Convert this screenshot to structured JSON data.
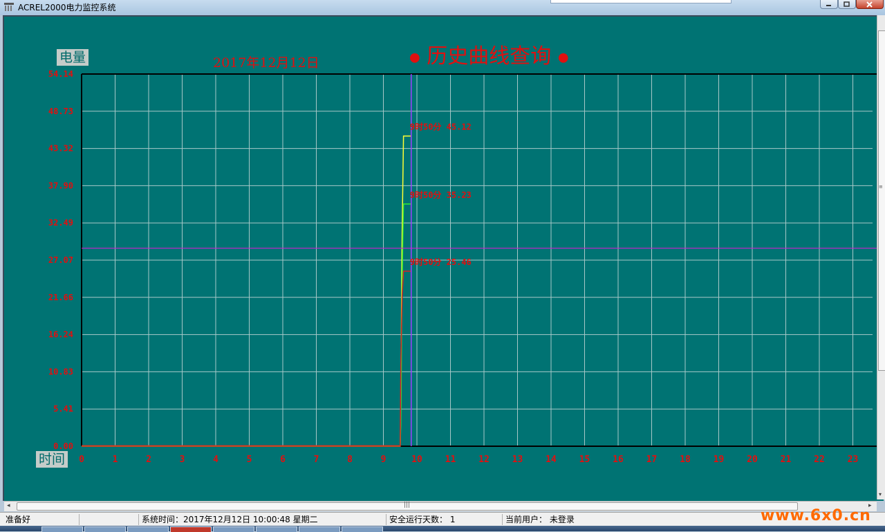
{
  "window": {
    "title": "ACREL2000电力监控系统"
  },
  "chart_labels": {
    "y_box": "电量",
    "x_box": "时间",
    "date": "2017年12月12日",
    "title": "历史曲线查询"
  },
  "chart_data": {
    "type": "line",
    "title": "历史曲线查询",
    "subtitle": "2017年12月12日",
    "xlabel": "时间",
    "ylabel": "电量",
    "xlim": [
      0,
      24
    ],
    "ylim": [
      0,
      54.14
    ],
    "x_ticks": [
      "0",
      "1",
      "2",
      "3",
      "4",
      "5",
      "6",
      "7",
      "8",
      "9",
      "10",
      "11",
      "12",
      "13",
      "14",
      "15",
      "16",
      "17",
      "18",
      "19",
      "20",
      "21",
      "22",
      "23"
    ],
    "y_ticks": [
      "0.00",
      "5.41",
      "10.83",
      "16.24",
      "21.66",
      "27.07",
      "32.49",
      "37.90",
      "43.32",
      "48.73",
      "54.14"
    ],
    "grid": true,
    "cursor": {
      "x": 9.83,
      "y": 28.8
    },
    "series": [
      {
        "color": "#ffff33",
        "values": [
          [
            0,
            0
          ],
          [
            9.5,
            0
          ],
          [
            9.52,
            5
          ],
          [
            9.55,
            28
          ],
          [
            9.58,
            38
          ],
          [
            9.6,
            45.12
          ],
          [
            9.83,
            45.12
          ]
        ]
      },
      {
        "color": "#33ee33",
        "values": [
          [
            0,
            0
          ],
          [
            9.5,
            0
          ],
          [
            9.52,
            3
          ],
          [
            9.55,
            20
          ],
          [
            9.58,
            30
          ],
          [
            9.6,
            35.23
          ],
          [
            9.83,
            35.23
          ]
        ]
      },
      {
        "color": "#dd2222",
        "values": [
          [
            0,
            0
          ],
          [
            9.5,
            0
          ],
          [
            9.52,
            12
          ],
          [
            9.56,
            22
          ],
          [
            9.6,
            25.46
          ],
          [
            9.83,
            25.46
          ]
        ]
      }
    ],
    "annotations": [
      {
        "text": "9时50分  45.12",
        "x": 9.83,
        "y": 45.12
      },
      {
        "text": "9时50分  35.23",
        "x": 9.83,
        "y": 35.23
      },
      {
        "text": "9时50分  25.46",
        "x": 9.83,
        "y": 25.46
      }
    ]
  },
  "status": {
    "ready": "准备好",
    "time": "系统时间：2017年12月12日  10:00:48   星期二",
    "safe_days": "安全运行天数：  1",
    "user": "当前用户：  未登录"
  },
  "watermark": "www.6x0.cn"
}
